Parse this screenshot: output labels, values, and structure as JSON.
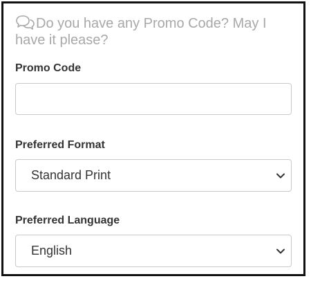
{
  "promo_prompt": {
    "icon": "chat-bubbles-icon",
    "text": "Do you have any Promo Code? May I have it please?"
  },
  "promo_code": {
    "label": "Promo Code",
    "value": "",
    "placeholder": ""
  },
  "preferred_format": {
    "label": "Preferred Format",
    "selected": "Standard Print",
    "icon": "chevron-down-icon"
  },
  "preferred_language": {
    "label": "Preferred Language",
    "selected": "English",
    "icon": "chevron-down-icon"
  },
  "colors": {
    "border": "#111111",
    "prompt_text": "#a8a8a8",
    "label_text": "#333333",
    "field_border": "#c9c9c9"
  }
}
